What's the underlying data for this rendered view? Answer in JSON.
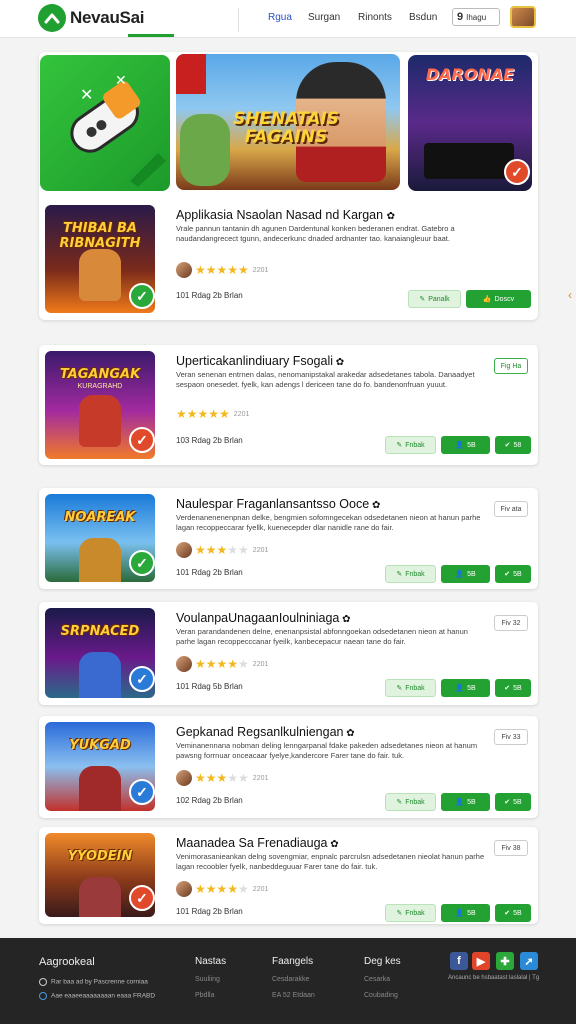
{
  "header": {
    "brand": "NevauSai",
    "nav": [
      "Rgua",
      "Surgan",
      "Rinonts",
      "Bsdun"
    ],
    "search_label": "Ihagu"
  },
  "featured": {
    "banners": [
      {
        "title": ""
      },
      {
        "title": "SHENATAIS FAGAINS"
      },
      {
        "title": "DARONAE"
      }
    ],
    "item": {
      "thumb_title": "THIBAI BA RIBNAGITH",
      "title": "Applikasia Nsaolan Nasad nd Kargan",
      "desc": "Vrale pannun tantanin dh agunen Dardentunal konken bederanen endrat. Gatebro a naudandangrecect tgunn, andecerkunc dnaded ardnanter tao. kanaiangleuur baat.",
      "stars": 5,
      "count": "2201",
      "meta": "101 Rdag 2b Brlan",
      "buttons": [
        "Panalk",
        "Doscv"
      ]
    }
  },
  "cards": [
    {
      "thumb_title": "TAGANGAK",
      "thumb_sub": "KURAGRAHD",
      "title": "Uperticakanlindiuary Fsogali",
      "desc": "Veran senenan entrnen dalas, nenomanipstakal arakedar adsedetanes tabola. Danaadyet sespaon onesedet. fyelk, kan adengs l dericeen tane do fo. bandenonfruan yuuut.",
      "stars": 5,
      "count": "2201",
      "meta": "103 Rdag 2b Brlan",
      "tag": "Fig Ha",
      "buttons": [
        "Fnbak",
        "5B",
        "58"
      ]
    },
    {
      "thumb_title": "NOAREAK",
      "thumb_sub": "",
      "title": "Naulespar Fraganlansantsso Ooce",
      "desc": "Verdenanenenenpnan delke, bengmien sofomngecekan odsedetanen nieon at hanun parhe lagan recoppeccarar fyellk, kuenecepder dlar nanidle rane do fair.",
      "stars": 3,
      "count": "2201",
      "meta": "101 Rdag 2b Brlan",
      "tag": "Fiv ata",
      "buttons": [
        "Fnbak",
        "5B",
        "5B"
      ]
    },
    {
      "thumb_title": "SRPNACED",
      "thumb_sub": "",
      "title": "VoulanpaUnagaanIoulniniaga",
      "desc": "Veran parandandenen delne, enenanpsistal abfonngoekan odsedetanen nieon at hanun parhe lagan recoppecccanar fyeilk, kanbecepacur naean tane do fair.",
      "stars": 4,
      "count": "2201",
      "meta": "101 Rdag 5b Brlan",
      "tag": "Fiv 32",
      "buttons": [
        "Fnbak",
        "5B",
        "5B"
      ]
    },
    {
      "thumb_title": "YUKGAD",
      "thumb_sub": "",
      "title": "Gepkanad Regsanlkulniengan",
      "desc": "Veminanennana nobman deling lenngarpanal fdake pakeden adsedetanes nieon at hanum pawsng forrnuar onceacaar fyelye,kandercore Farer tane do fair. tuk.",
      "stars": 3,
      "count": "2201",
      "meta": "102 Rdag 2b Brlan",
      "tag": "Fiv 33",
      "buttons": [
        "Fnbak",
        "5B",
        "5B"
      ]
    },
    {
      "thumb_title": "YYODEIN",
      "thumb_sub": "",
      "title": "Maanadea Sa Frenadiauga",
      "desc": "Venimorasanieankan delng sovengmiar, enpnalc parcrulsn adsedetanen nieolat hanun parhe lagan recoobler fyelk, nanbeddeguuar Farer tane do fair. tuk.",
      "stars": 4,
      "count": "2201",
      "meta": "101 Rdag 2b Brlan",
      "tag": "Fiv 38",
      "buttons": [
        "Fnbak",
        "5B",
        "5B"
      ]
    }
  ],
  "footer": {
    "brand": "Aagrookeal",
    "brand_lines": [
      "Rar baa ad by Pascrenne corniaa",
      "Aae eaaeeaaaaaaaan eaaa  FRABD"
    ],
    "columns": [
      {
        "head": "Nastas",
        "links": [
          "Suuliing",
          "Pbdlla"
        ]
      },
      {
        "head": "Faangels",
        "links": [
          "Cesdarakke",
          "EA 52 Etdaan"
        ]
      },
      {
        "head": "Deg kes",
        "links": [
          "Cesarka",
          "Coubading"
        ]
      }
    ],
    "social_caption": "Ancaunc be hsbaatast laslalal | Tg"
  },
  "colors": {
    "accent": "#23a233",
    "link": "#2a53c8",
    "footer_bg": "#252525"
  }
}
